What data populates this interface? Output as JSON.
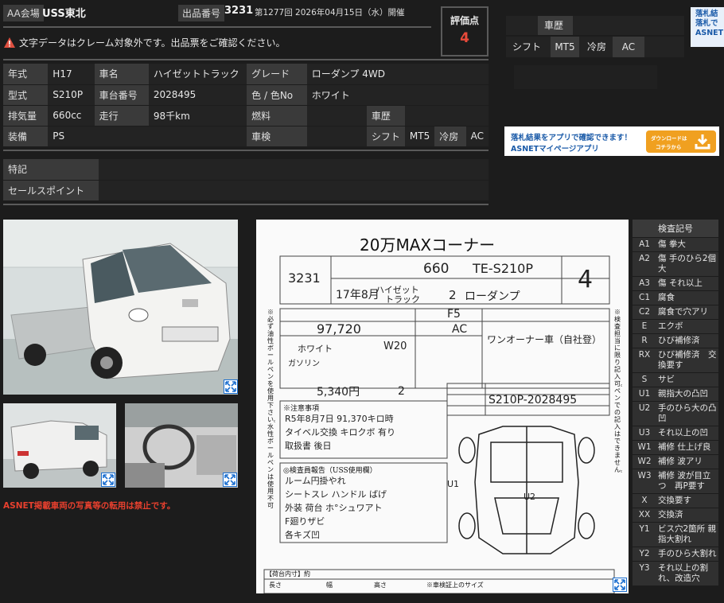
{
  "header": {
    "venue_label": "AA会場",
    "venue": "USS東北",
    "lot_label": "出品番号",
    "lot_no": "3231",
    "session": "第1277回 2026年04月15日（水）開催"
  },
  "warning": "文字データはクレーム対象外です。出品票をご確認ください。",
  "score": {
    "label": "評価点",
    "value": "4"
  },
  "specs": {
    "nensiki_label": "年式",
    "nensiki": "H17",
    "model_name_label": "車名",
    "model_name": "ハイゼットトラック",
    "grade_label": "グレード",
    "grade": "ローダンプ 4WD",
    "type_label": "型式",
    "type": "S210P",
    "chassis_label": "車台番号",
    "chassis": "2028495",
    "color_label": "色 / 色No",
    "color": "ホワイト",
    "displacement_label": "排気量",
    "displacement": "660cc",
    "mileage_label": "走行",
    "mileage": "98千km",
    "fuel_label": "燃料",
    "fuel": "",
    "history_label": "車歴",
    "history": "",
    "equip_label": "装備",
    "equip": "PS",
    "inspection_label": "車検",
    "inspection": "",
    "shift_label": "シフト",
    "shift": "MT5",
    "ac_label": "冷房",
    "ac": "AC",
    "special_label": "特記",
    "special": "",
    "sales_label": "セールスポイント",
    "sales": ""
  },
  "top_right": {
    "history_label": "車歴",
    "shift_label": "シフト",
    "shift": "MT5",
    "ac_label": "冷房",
    "ac": "AC",
    "promo_cut": "落札結\n落札で\nASNET"
  },
  "banner": {
    "line1": "落札結果をアプリで確認できます！",
    "line2": "ASNETマイページアプリ",
    "btn1": "ダウンロードは",
    "btn2": "コチラから"
  },
  "notice": "ASNET掲載車両の写真等の転用は禁止です。",
  "sheet": {
    "title": "20万MAXコーナー",
    "lot": "3231",
    "displacement": "660",
    "type": "TE-S210P",
    "score": "4",
    "year": "17年8月",
    "name1": "ハイゼット",
    "name2": "トラック",
    "doors": "2",
    "grade": "ローダンプ",
    "shift": "F5",
    "mileage": "97,720",
    "ac": "AC",
    "color": "ホワイト",
    "color_no": "W20",
    "fuel": "ガソリン",
    "recycle": "5,340円",
    "seats": "2",
    "sales_point": "ワンオーナー車（自社登）",
    "chassis": "S210P-2028495",
    "notes_hw": "R5年8月7日 91,370キロ時\nタイベル交換 キロクボ 有り\n取扱書 後日",
    "inspector_hw": "ルーム円掛やれ\nシートスレ ハンドル ばげ\n外装 荷台 ホ°シュワアト\nF廻りザビ\n各キズ凹",
    "u1": "U1",
    "u2": "U2",
    "labels": {
      "caution": "※注意事項",
      "inspector": "◎検査員報告（USS使用欄）",
      "size": "【荷台内寸】約",
      "length": "長さ",
      "width": "幅",
      "height": "高さ",
      "side_note": "※必ず油性ボールペンを使用下さい。水性ボールペンは使用不可",
      "right_note": "※検査担当に限り記入可。ペンでの記入はできません。",
      "kikaku": "※車検証上のサイズ"
    }
  },
  "inspection_codes": {
    "title": "検査記号",
    "rows": [
      {
        "code": "A1",
        "desc": "傷 拳大"
      },
      {
        "code": "A2",
        "desc": "傷 手のひら2個大"
      },
      {
        "code": "A3",
        "desc": "傷 それ以上"
      },
      {
        "code": "C1",
        "desc": "腐食"
      },
      {
        "code": "C2",
        "desc": "腐食で穴アリ"
      },
      {
        "code": "E",
        "desc": "エクボ"
      },
      {
        "code": "R",
        "desc": "ひび補修済"
      },
      {
        "code": "RX",
        "desc": "ひび補修済　交換要す"
      },
      {
        "code": "S",
        "desc": "サビ"
      },
      {
        "code": "U1",
        "desc": "親指大の凸凹"
      },
      {
        "code": "U2",
        "desc": "手のひら大の凸凹"
      },
      {
        "code": "U3",
        "desc": "それ以上の凹"
      },
      {
        "code": "W1",
        "desc": "補修 仕上げ良"
      },
      {
        "code": "W2",
        "desc": "補修 波アリ"
      },
      {
        "code": "W3",
        "desc": "補修 波が目立つ　再P要す"
      },
      {
        "code": "X",
        "desc": "交換要す"
      },
      {
        "code": "XX",
        "desc": "交換済"
      },
      {
        "code": "Y1",
        "desc": "ビス穴2箇所 親指大割れ"
      },
      {
        "code": "Y2",
        "desc": "手のひら大割れ"
      },
      {
        "code": "Y3",
        "desc": "それ以上の割れ、改造穴"
      }
    ]
  }
}
